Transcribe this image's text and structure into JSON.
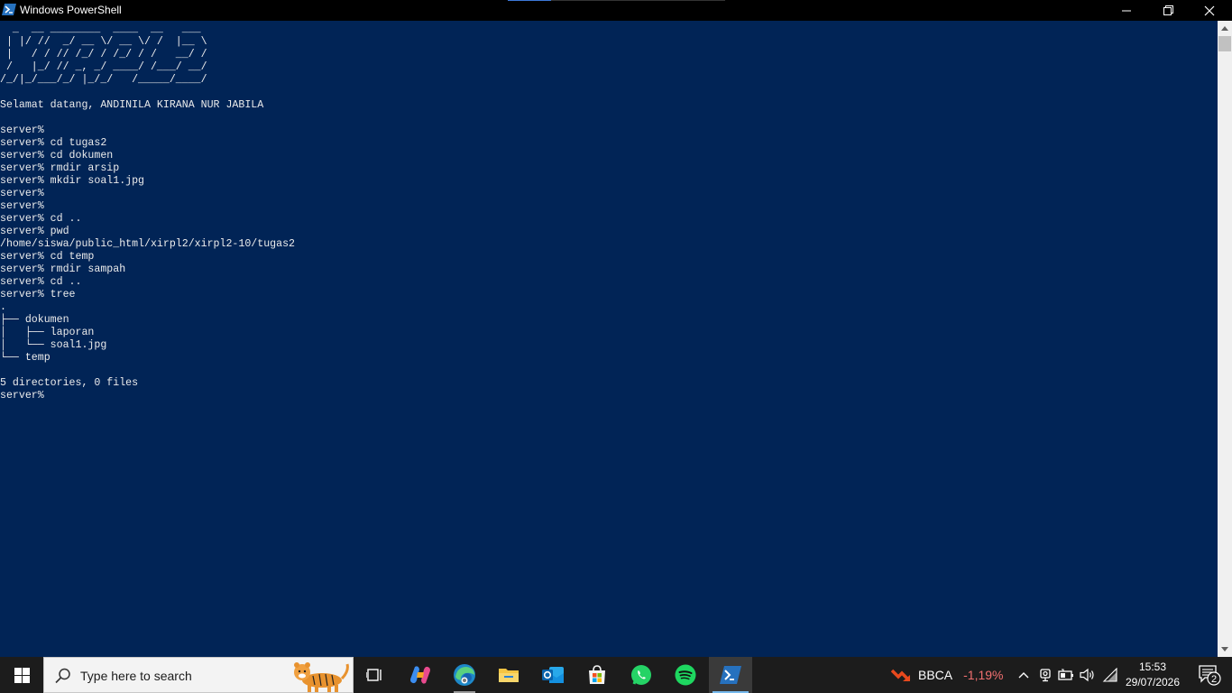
{
  "window": {
    "title": "Windows PowerShell",
    "icon": "powershell-icon",
    "controls": [
      "minimize-icon",
      "restore-icon",
      "close-icon"
    ]
  },
  "console": {
    "banner": [
      "  _  __ ________  ____  __   ___",
      " | |/ //  _/ __ \\/ __ \\/ /  |__ \\",
      " |   / / // /_/ / /_/ / /   __/ /",
      " /   |_/ // _, _/ ____/ /___/ __/",
      "/_/|_/___/_/ |_/_/   /_____/____/"
    ],
    "lines": [
      "Selamat datang, ANDINILA KIRANA NUR JABILA",
      "",
      "server%",
      "server% cd tugas2",
      "server% cd dokumen",
      "server% rmdir arsip",
      "server% mkdir soal1.jpg",
      "server%",
      "server%",
      "server% cd ..",
      "server% pwd",
      "/home/siswa/public_html/xirpl2/xirpl2-10/tugas2",
      "server% cd temp",
      "server% rmdir sampah",
      "server% cd ..",
      "server% tree",
      ".",
      "├── dokumen",
      "│   ├── laporan",
      "│   └── soal1.jpg",
      "└── temp",
      "",
      "5 directories, 0 files",
      "server%"
    ]
  },
  "taskbar": {
    "start_icon": "windows-start-icon",
    "search_placeholder": "Type here to search",
    "apps": [
      {
        "name": "task-view-icon"
      },
      {
        "name": "copilot-icon"
      },
      {
        "name": "edge-icon"
      },
      {
        "name": "file-explorer-icon"
      },
      {
        "name": "outlook-icon"
      },
      {
        "name": "microsoft-store-icon"
      },
      {
        "name": "whatsapp-icon"
      },
      {
        "name": "spotify-icon"
      },
      {
        "name": "powershell-icon"
      }
    ],
    "stock": {
      "symbol": "BBCA",
      "change": "-1,19%",
      "change_color": "#f27070"
    },
    "tray_icons": [
      "chevron-up-icon",
      "meet-now-icon",
      "battery-icon",
      "volume-icon",
      "wifi-icon"
    ],
    "time": "15:53",
    "date": "29/07/2026",
    "notification_count": "2"
  },
  "colors": {
    "console_bg": "#012456",
    "console_fg": "#ececec",
    "titlebar_bg": "#000000",
    "taskbar_bg": "#1c1c1c"
  }
}
